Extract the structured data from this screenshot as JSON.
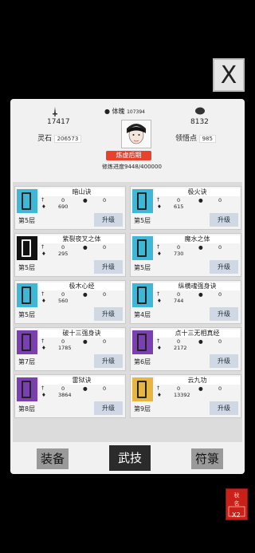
{
  "close_glyph": "X",
  "stats": {
    "attack": "17417",
    "body_label": "体魄",
    "body_value": "107394",
    "defense": "8132",
    "spirit_label": "灵石",
    "spirit_value": "206573",
    "insight_label": "领悟点",
    "insight_value": "985"
  },
  "realm": "炼虚后期",
  "progress_label": "修炼进度",
  "progress_value": "9448/400000",
  "upgrade_label": "升级",
  "skills": [
    {
      "name": "暗山诀",
      "a": "0",
      "b": "0",
      "c": "690",
      "layer": "第5层",
      "color": "#3fb8d8"
    },
    {
      "name": "极火诀",
      "a": "0",
      "b": "0",
      "c": "615",
      "layer": "第5层",
      "color": "#3fb8d8"
    },
    {
      "name": "紫裂夜叉之体",
      "a": "0",
      "b": "0",
      "c": "295",
      "layer": "第5层",
      "color": "#111111"
    },
    {
      "name": "魔水之体",
      "a": "0",
      "b": "0",
      "c": "730",
      "layer": "第5层",
      "color": "#3fb8d8"
    },
    {
      "name": "极木心经",
      "a": "0",
      "b": "0",
      "c": "560",
      "layer": "第5层",
      "color": "#3fb8d8"
    },
    {
      "name": "纵横魂强身诀",
      "a": "0",
      "b": "0",
      "c": "744",
      "layer": "第4层",
      "color": "#3fb8d8"
    },
    {
      "name": "破十三强身诀",
      "a": "0",
      "b": "0",
      "c": "1785",
      "layer": "第7层",
      "color": "#7a3fb0"
    },
    {
      "name": "点十三无相真经",
      "a": "0",
      "b": "0",
      "c": "2172",
      "layer": "第6层",
      "color": "#7a3fb0"
    },
    {
      "name": "雷狱诀",
      "a": "0",
      "b": "0",
      "c": "3864",
      "layer": "第8层",
      "color": "#7a3fb0"
    },
    {
      "name": "云九功",
      "a": "0",
      "b": "0",
      "c": "13392",
      "layer": "第9层",
      "color": "#e7b640"
    }
  ],
  "tabs": [
    "装备",
    "武技",
    "符箓"
  ],
  "multiplier": "X2",
  "seal_text": "秋 名  之 诏  令"
}
